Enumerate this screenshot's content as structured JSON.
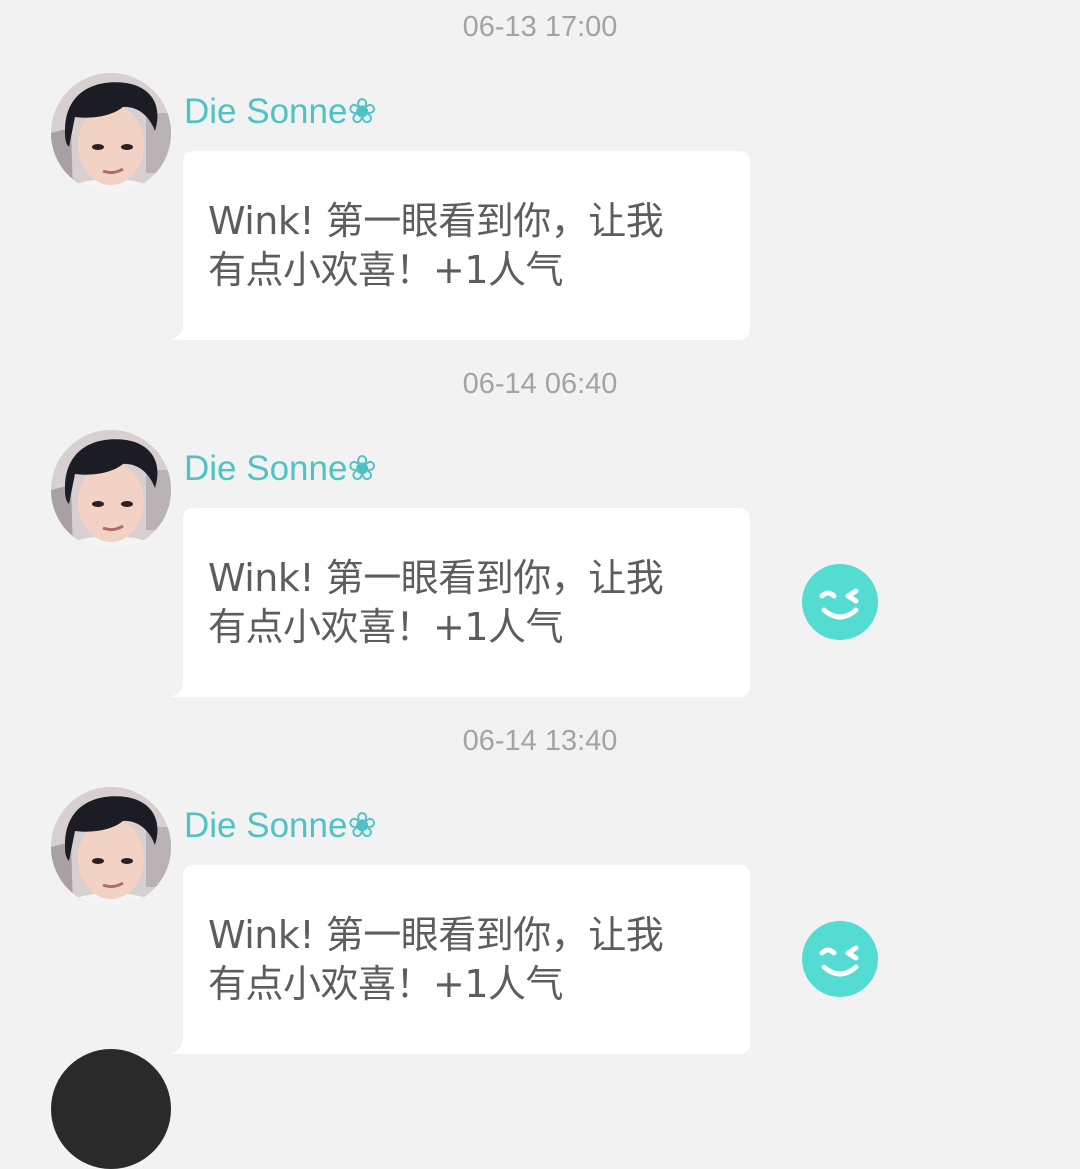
{
  "messages": [
    {
      "timestamp": "06-13 17:00",
      "sender": "Die Sonne❀",
      "text_line1": "Wink! 第一眼看到你，让我",
      "text_line2": "有点小欢喜！+1人气",
      "has_wink_icon": false
    },
    {
      "timestamp": "06-14 06:40",
      "sender": "Die Sonne❀",
      "text_line1": "Wink! 第一眼看到你，让我",
      "text_line2": "有点小欢喜！+1人气",
      "has_wink_icon": true
    },
    {
      "timestamp": "06-14 13:40",
      "sender": "Die Sonne❀",
      "text_line1": "Wink! 第一眼看到你，让我",
      "text_line2": "有点小欢喜！+1人气",
      "has_wink_icon": true
    }
  ],
  "colors": {
    "background": "#f2f2f2",
    "sender_name": "#4fc3c4",
    "timestamp": "#a3a3a3",
    "message_text": "#5d5d5d",
    "wink_icon": "#54dbd2"
  },
  "icons": {
    "wink": "wink-face-icon"
  }
}
